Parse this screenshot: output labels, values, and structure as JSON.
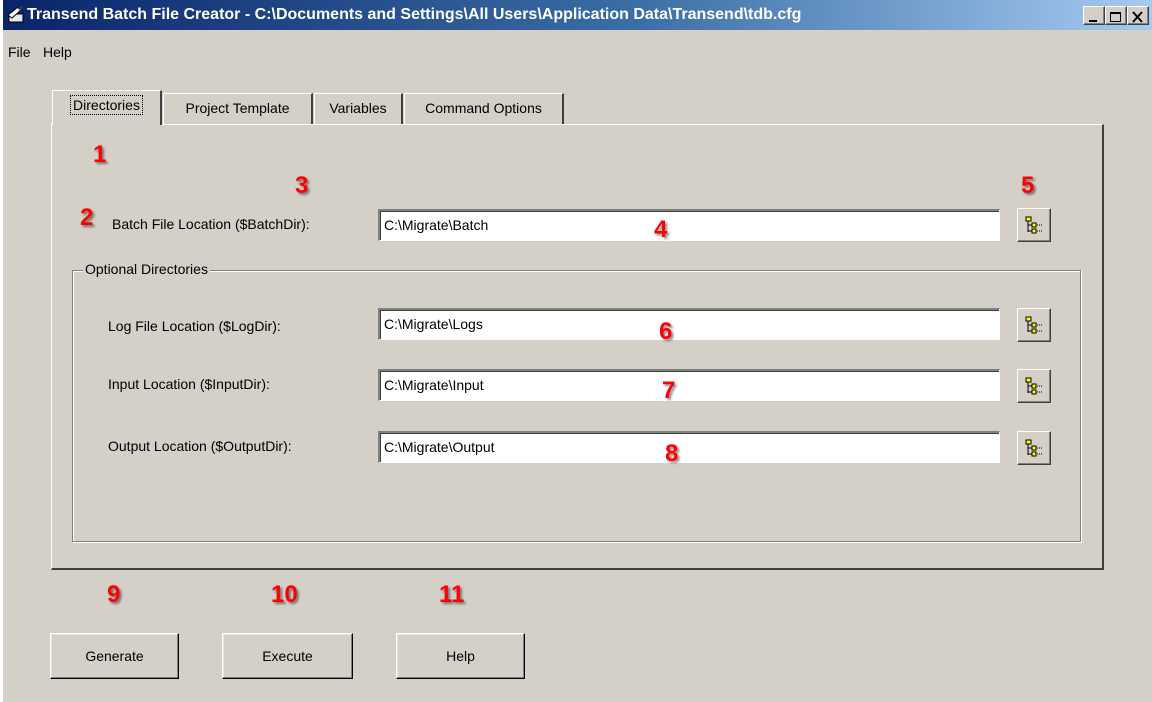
{
  "window": {
    "title": "Transend Batch File Creator - C:\\Documents and Settings\\All Users\\Application Data\\Transend\\tdb.cfg"
  },
  "menu": {
    "file": "File",
    "help": "Help"
  },
  "tabs": [
    "Directories",
    "Project Template",
    "Variables",
    "Command Options"
  ],
  "directories": {
    "batch_label": "Batch File Location ($BatchDir):",
    "batch_value": "C:\\Migrate\\Batch",
    "optional_group": "Optional Directories",
    "log_label": "Log File Location ($LogDir):",
    "log_value": "C:\\Migrate\\Logs",
    "input_label": "Input Location ($InputDir):",
    "input_value": "C:\\Migrate\\Input",
    "output_label": "Output Location ($OutputDir):",
    "output_value": "C:\\Migrate\\Output"
  },
  "buttons": {
    "generate": "Generate",
    "execute": "Execute",
    "help": "Help"
  },
  "annotations": [
    "1",
    "2",
    "3",
    "4",
    "5",
    "6",
    "7",
    "8",
    "9",
    "10",
    "11"
  ],
  "colors": {
    "annotation": "#ff0000",
    "titlebar_start": "#0a246a",
    "titlebar_end": "#a6caf0",
    "face": "#d4d0c8"
  },
  "icons": {
    "app": "app-icon",
    "browse": "folder-tree-icon",
    "minimize": "minimize-icon",
    "maximize": "maximize-icon",
    "close": "close-icon"
  }
}
